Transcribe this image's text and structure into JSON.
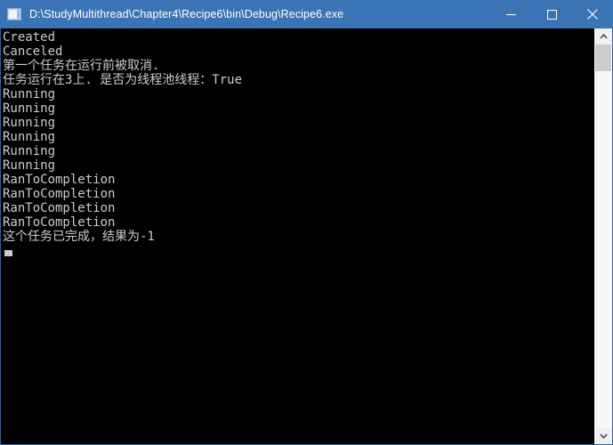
{
  "window": {
    "title": "D:\\StudyMultithread\\Chapter4\\Recipe6\\bin\\Debug\\Recipe6.exe",
    "icon": "console-app-icon",
    "titlebar_color": "#3b74b4",
    "background_color": "#000000",
    "text_color": "#cccccc",
    "controls": {
      "minimize": "─",
      "maximize": "□",
      "close": "✕"
    }
  },
  "console": {
    "lines": [
      "Created",
      "Canceled",
      "第一个任务在运行前被取消.",
      "任务运行在3上. 是否为线程池线程：True",
      "Running",
      "Running",
      "Running",
      "Running",
      "Running",
      "Running",
      "RanToCompletion",
      "RanToCompletion",
      "RanToCompletion",
      "RanToCompletion",
      "这个任务已完成，结果为-1"
    ],
    "cursor": "block-cursor"
  },
  "scrollbar": {
    "up_arrow": "chevron-up-icon",
    "down_arrow": "chevron-down-icon",
    "thumb_position_percent": 0,
    "thumb_size_percent": 7
  }
}
